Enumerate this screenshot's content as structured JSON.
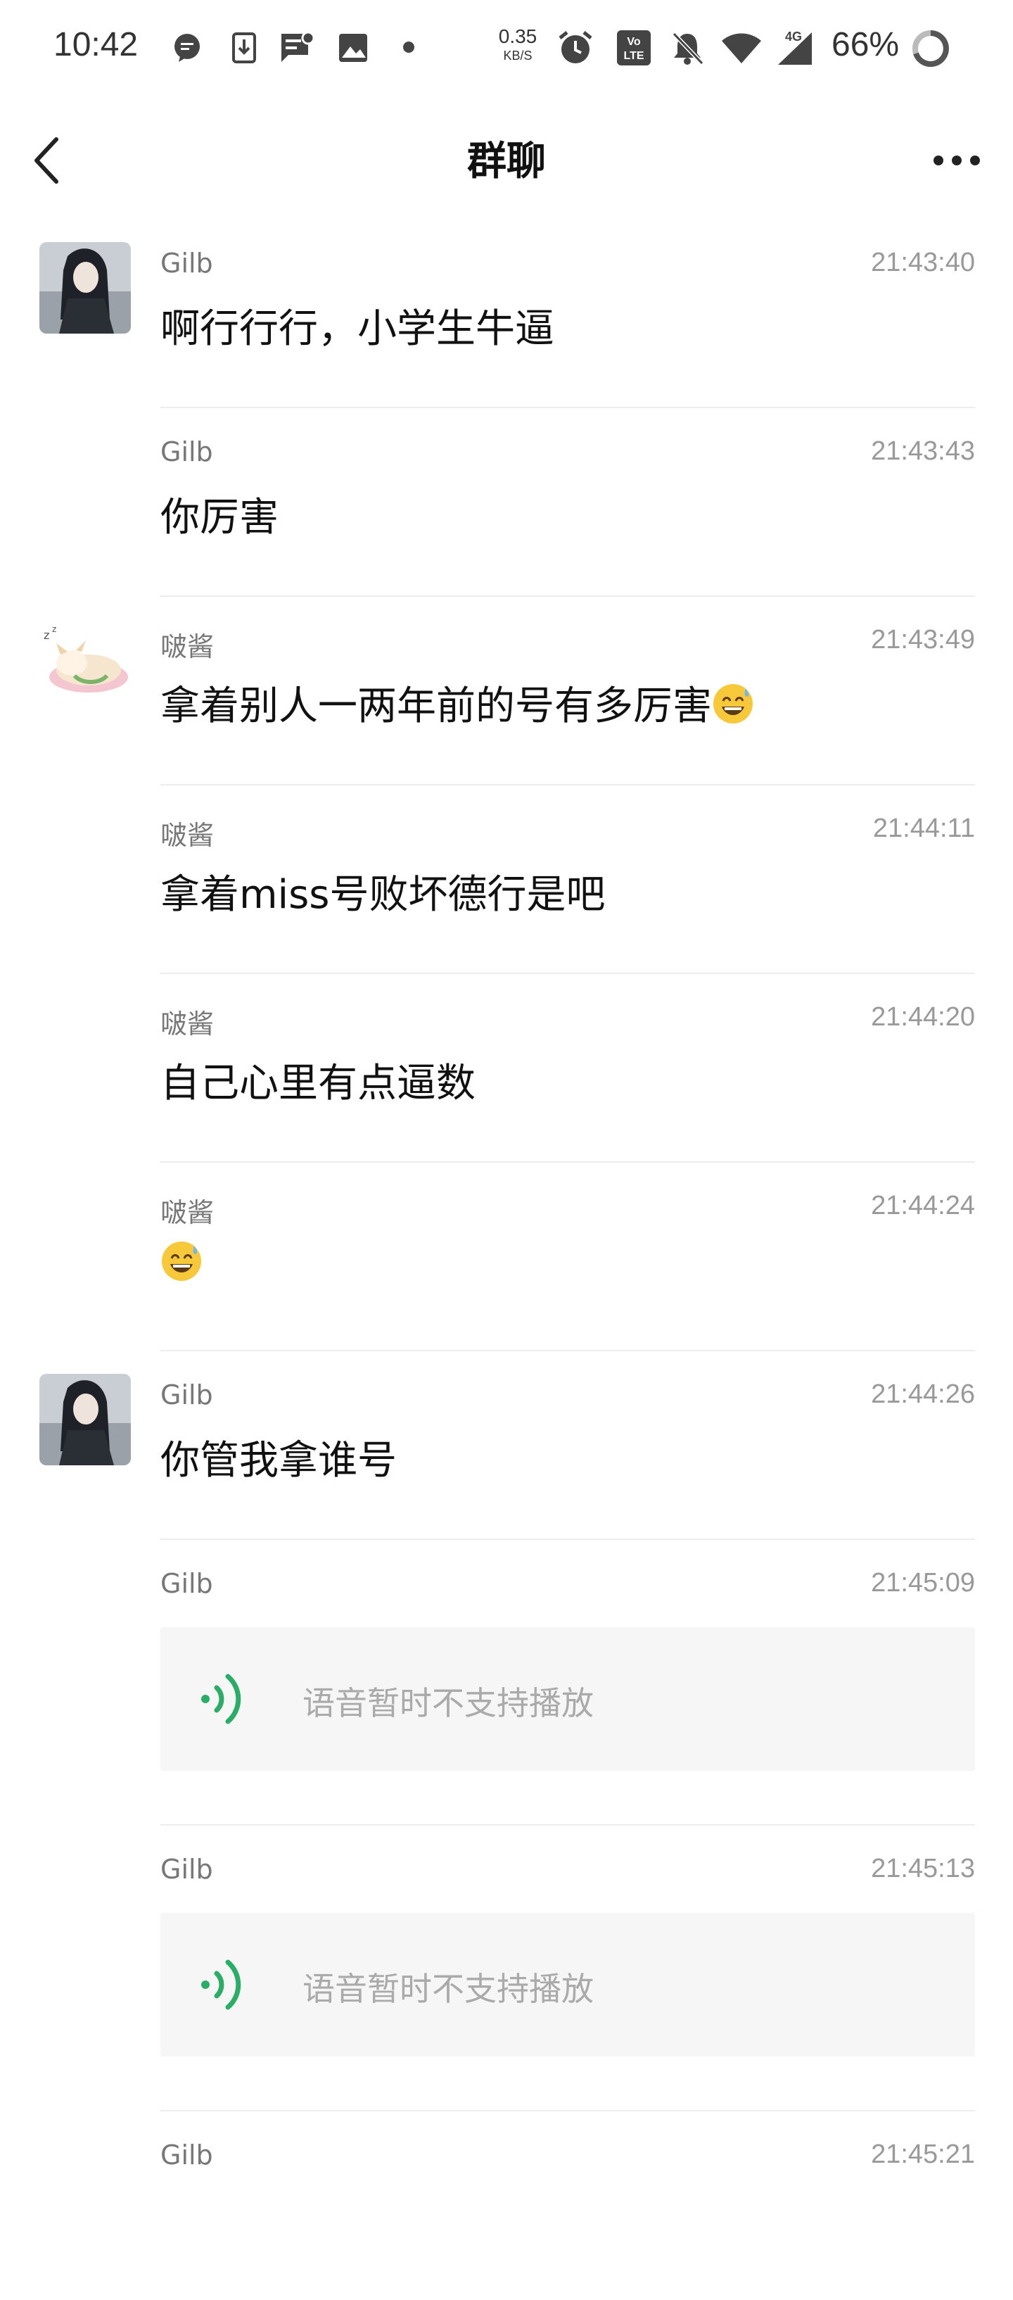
{
  "status_bar": {
    "time": "10:42",
    "net_speed_value": "0.35",
    "net_speed_unit": "KB/S",
    "network_type": "4G",
    "volte_label": "VoLTE",
    "battery": "66%",
    "icons": [
      "chat-bubble-icon",
      "download-icon",
      "message-notification-icon",
      "image-icon",
      "dot-icon",
      "alarm-icon",
      "volte-icon",
      "bell-off-icon",
      "wifi-icon",
      "signal-icon",
      "battery-ring-icon"
    ]
  },
  "title_bar": {
    "title": "群聊",
    "back_icon": "back-chevron-icon",
    "more_icon": "more-dots-icon"
  },
  "colors": {
    "accent_green": "#2aae67",
    "separator": "#ececec",
    "voice_bg": "#f6f6f6"
  },
  "messages": [
    {
      "sender": "Gilb",
      "time": "21:43:40",
      "text": "啊行行行，小学生牛逼",
      "avatar": "gilb-avatar"
    },
    {
      "sender": "Gilb",
      "time": "21:43:43",
      "text": "你厉害"
    },
    {
      "sender": "啵酱",
      "time": "21:43:49",
      "text": "拿着别人一两年前的号有多厉害",
      "emoji": "sweat-smile-emoji",
      "avatar": "bojiang-avatar"
    },
    {
      "sender": "啵酱",
      "time": "21:44:11",
      "text": "拿着miss号败坏德行是吧"
    },
    {
      "sender": "啵酱",
      "time": "21:44:20",
      "text": "自己心里有点逼数"
    },
    {
      "sender": "啵酱",
      "time": "21:44:24",
      "text": "",
      "emoji": "sweat-smile-emoji"
    },
    {
      "sender": "Gilb",
      "time": "21:44:26",
      "text": "你管我拿谁号",
      "avatar": "gilb-avatar"
    },
    {
      "sender": "Gilb",
      "time": "21:45:09",
      "voice": "语音暂时不支持播放"
    },
    {
      "sender": "Gilb",
      "time": "21:45:13",
      "voice": "语音暂时不支持播放"
    },
    {
      "sender": "Gilb",
      "time": "21:45:21"
    }
  ]
}
